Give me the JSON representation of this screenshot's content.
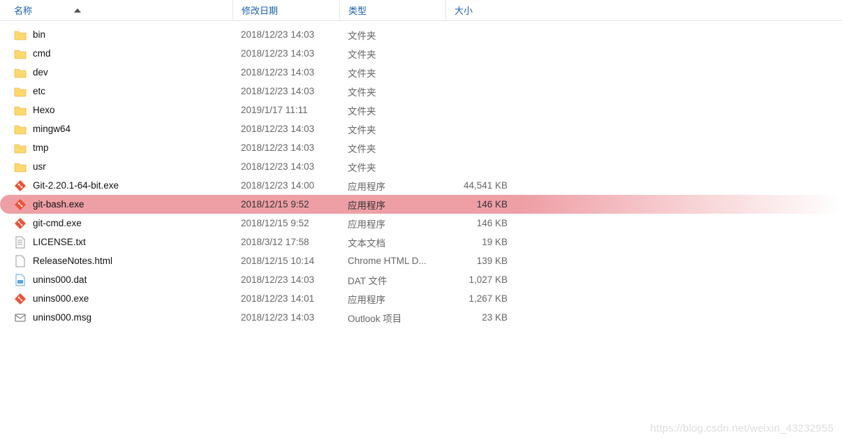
{
  "columns": {
    "name": "名称",
    "date": "修改日期",
    "type": "类型",
    "size": "大小"
  },
  "rows": [
    {
      "icon": "folder",
      "name": "bin",
      "date": "2018/12/23 14:03",
      "type": "文件夹",
      "size": "",
      "hl": false
    },
    {
      "icon": "folder",
      "name": "cmd",
      "date": "2018/12/23 14:03",
      "type": "文件夹",
      "size": "",
      "hl": false
    },
    {
      "icon": "folder",
      "name": "dev",
      "date": "2018/12/23 14:03",
      "type": "文件夹",
      "size": "",
      "hl": false
    },
    {
      "icon": "folder",
      "name": "etc",
      "date": "2018/12/23 14:03",
      "type": "文件夹",
      "size": "",
      "hl": false
    },
    {
      "icon": "folder",
      "name": "Hexo",
      "date": "2019/1/17 11:11",
      "type": "文件夹",
      "size": "",
      "hl": false
    },
    {
      "icon": "folder",
      "name": "mingw64",
      "date": "2018/12/23 14:03",
      "type": "文件夹",
      "size": "",
      "hl": false
    },
    {
      "icon": "folder",
      "name": "tmp",
      "date": "2018/12/23 14:03",
      "type": "文件夹",
      "size": "",
      "hl": false
    },
    {
      "icon": "folder",
      "name": "usr",
      "date": "2018/12/23 14:03",
      "type": "文件夹",
      "size": "",
      "hl": false
    },
    {
      "icon": "git",
      "name": "Git-2.20.1-64-bit.exe",
      "date": "2018/12/23 14:00",
      "type": "应用程序",
      "size": "44,541 KB",
      "hl": false
    },
    {
      "icon": "git",
      "name": "git-bash.exe",
      "date": "2018/12/15 9:52",
      "type": "应用程序",
      "size": "146 KB",
      "hl": true
    },
    {
      "icon": "git",
      "name": "git-cmd.exe",
      "date": "2018/12/15 9:52",
      "type": "应用程序",
      "size": "146 KB",
      "hl": false
    },
    {
      "icon": "txt",
      "name": "LICENSE.txt",
      "date": "2018/3/12 17:58",
      "type": "文本文档",
      "size": "19 KB",
      "hl": false
    },
    {
      "icon": "html",
      "name": "ReleaseNotes.html",
      "date": "2018/12/15 10:14",
      "type": "Chrome HTML D...",
      "size": "139 KB",
      "hl": false
    },
    {
      "icon": "dat",
      "name": "unins000.dat",
      "date": "2018/12/23 14:03",
      "type": "DAT 文件",
      "size": "1,027 KB",
      "hl": false
    },
    {
      "icon": "git",
      "name": "unins000.exe",
      "date": "2018/12/23 14:01",
      "type": "应用程序",
      "size": "1,267 KB",
      "hl": false
    },
    {
      "icon": "msg",
      "name": "unins000.msg",
      "date": "2018/12/23 14:03",
      "type": "Outlook 项目",
      "size": "23 KB",
      "hl": false
    }
  ],
  "watermark": "https://blog.csdn.net/weixin_43232955"
}
